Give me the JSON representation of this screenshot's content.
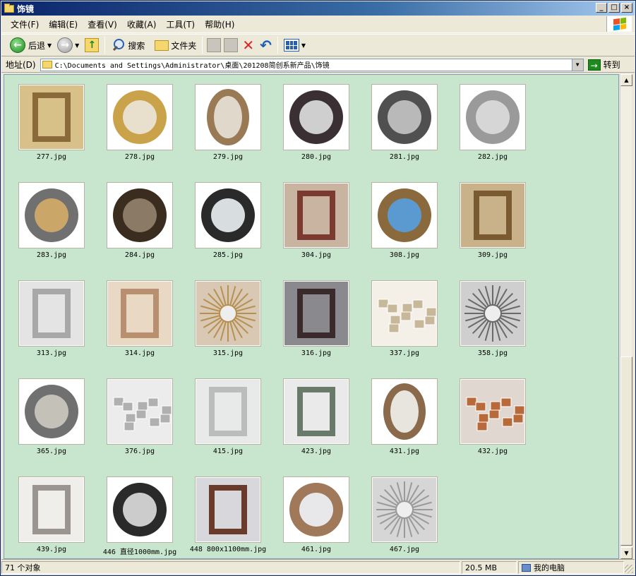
{
  "window": {
    "title": "饰镜"
  },
  "menu": [
    "文件(F)",
    "编辑(E)",
    "查看(V)",
    "收藏(A)",
    "工具(T)",
    "帮助(H)"
  ],
  "toolbar": {
    "back": "后退",
    "search": "搜索",
    "folders": "文件夹"
  },
  "address": {
    "label": "地址(D)",
    "path": "C:\\Documents and Settings\\Administrator\\桌面\\201208简创系新产品\\饰镜",
    "go": "转到"
  },
  "files": [
    {
      "name": "277.jpg",
      "kind": "rect",
      "c1": "#8b6a3a",
      "c2": "#d8c089"
    },
    {
      "name": "278.jpg",
      "kind": "round",
      "c1": "#c9a24a",
      "c2": "#e8e0cc"
    },
    {
      "name": "279.jpg",
      "kind": "oval",
      "c1": "#9a7a55",
      "c2": "#e0d8ca"
    },
    {
      "name": "280.jpg",
      "kind": "round",
      "c1": "#3a3034",
      "c2": "#cfcfd0"
    },
    {
      "name": "281.jpg",
      "kind": "round",
      "c1": "#505050",
      "c2": "#b9b9b9"
    },
    {
      "name": "282.jpg",
      "kind": "round",
      "c1": "#9a9a9a",
      "c2": "#d6d6d6"
    },
    {
      "name": "283.jpg",
      "kind": "round",
      "c1": "#707070",
      "c2": "#caa668"
    },
    {
      "name": "284.jpg",
      "kind": "round",
      "c1": "#3a2c1e",
      "c2": "#8a7a66"
    },
    {
      "name": "285.jpg",
      "kind": "round",
      "c1": "#2a2a2a",
      "c2": "#d8dde0"
    },
    {
      "name": "304.jpg",
      "kind": "rect",
      "c1": "#7a3a30",
      "c2": "#c8b4a0"
    },
    {
      "name": "308.jpg",
      "kind": "round",
      "c1": "#8a6a3c",
      "c2": "#5a9ad0"
    },
    {
      "name": "309.jpg",
      "kind": "rect",
      "c1": "#7a5a30",
      "c2": "#c9b28a"
    },
    {
      "name": "313.jpg",
      "kind": "rect",
      "c1": "#a8a8a8",
      "c2": "#e4e4e4"
    },
    {
      "name": "314.jpg",
      "kind": "rect",
      "c1": "#b89070",
      "c2": "#e8d8c4"
    },
    {
      "name": "315.jpg",
      "kind": "sun",
      "c1": "#b89050",
      "c2": "#d8c8b4"
    },
    {
      "name": "316.jpg",
      "kind": "rect",
      "c1": "#3a2a2c",
      "c2": "#8a8a8e"
    },
    {
      "name": "337.jpg",
      "kind": "tiles",
      "c1": "#c8b89a",
      "c2": "#f4f0e8"
    },
    {
      "name": "358.jpg",
      "kind": "sun",
      "c1": "#6a6a6a",
      "c2": "#cfcfcf"
    },
    {
      "name": "365.jpg",
      "kind": "round",
      "c1": "#707070",
      "c2": "#c4c2b8"
    },
    {
      "name": "376.jpg",
      "kind": "tiles",
      "c1": "#b0b0b0",
      "c2": "#ececec"
    },
    {
      "name": "415.jpg",
      "kind": "rect",
      "c1": "#bcbcbc",
      "c2": "#e8eaea"
    },
    {
      "name": "423.jpg",
      "kind": "rect",
      "c1": "#6a7a6a",
      "c2": "#eaeaea"
    },
    {
      "name": "431.jpg",
      "kind": "oval",
      "c1": "#8a6a4a",
      "c2": "#e8e4de"
    },
    {
      "name": "432.jpg",
      "kind": "tiles",
      "c1": "#b86a3a",
      "c2": "#e0d8d0"
    },
    {
      "name": "439.jpg",
      "kind": "rect",
      "c1": "#9a9590",
      "c2": "#f0eeea"
    },
    {
      "name": "446 直径1000mm.jpg",
      "kind": "round",
      "c1": "#2a2a2a",
      "c2": "#cccccc"
    },
    {
      "name": "448 800x1100mm.jpg",
      "kind": "rect",
      "c1": "#6a3a2a",
      "c2": "#d8d8dc"
    },
    {
      "name": "461.jpg",
      "kind": "round",
      "c1": "#a0785a",
      "c2": "#e8e8ea"
    },
    {
      "name": "467.jpg",
      "kind": "sun",
      "c1": "#9a9a9a",
      "c2": "#d6d6d6"
    }
  ],
  "status": {
    "count": "71 个对象",
    "size": "20.5 MB",
    "location": "我的电脑"
  }
}
